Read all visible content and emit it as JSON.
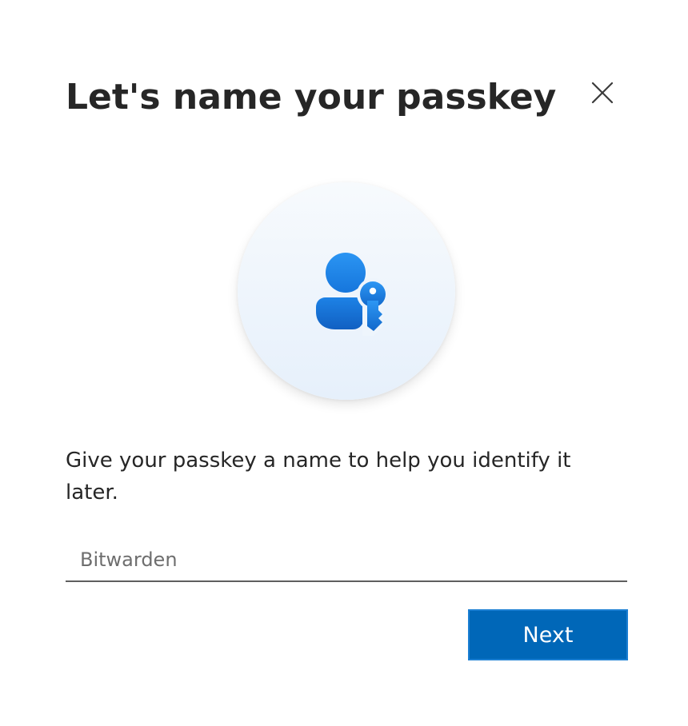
{
  "dialog": {
    "title": "Let's name your passkey",
    "close_icon": "close-icon",
    "illustration_icon": "person-key-icon",
    "description": "Give your passkey a name to help you identify it later.",
    "name_input": {
      "value": "",
      "placeholder": "Bitwarden"
    },
    "next_label": "Next"
  },
  "colors": {
    "accent": "#0067b8",
    "icon_blue": "#1a7ee6",
    "text": "#262626"
  }
}
